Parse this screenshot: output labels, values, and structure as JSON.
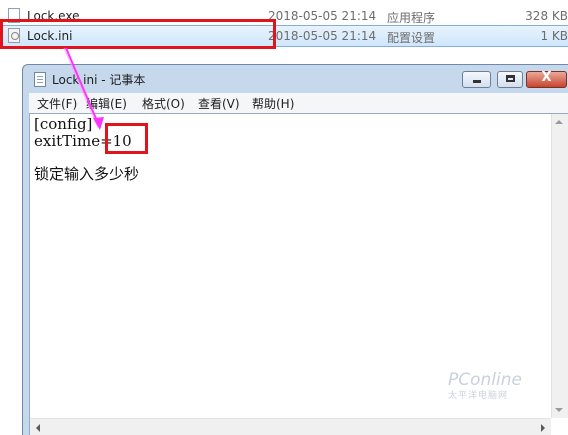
{
  "explorer": {
    "files": [
      {
        "name": "Lock.exe",
        "date": "2018-05-05 21:14",
        "type": "应用程序",
        "size": "328 KB",
        "selected": false
      },
      {
        "name": "Lock.ini",
        "date": "2018-05-05 21:14",
        "type": "配置设置",
        "size": "1 KB",
        "selected": true
      }
    ]
  },
  "notepad": {
    "title": "Lock.ini - 记事本",
    "menu": {
      "file": "文件(F)",
      "edit": "编辑(E)",
      "format": "格式(O)",
      "view": "查看(V)",
      "help": "帮助(H)"
    },
    "content": {
      "line1": "[config]",
      "line2": "exitTime=10",
      "note": "锁定输入多少秒"
    },
    "buttons": {
      "close_glyph": "X"
    }
  },
  "watermark": {
    "main": "PConline",
    "sub": "太平洋电脑网"
  },
  "colors": {
    "highlight": "#e0141b",
    "pointer": "#ff33ff",
    "selection": "#cfe6fb"
  }
}
